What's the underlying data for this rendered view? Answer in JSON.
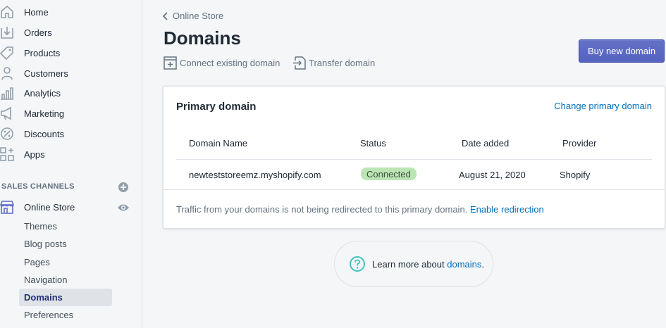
{
  "sidebar": {
    "items": [
      {
        "label": "Home",
        "icon": "home-icon"
      },
      {
        "label": "Orders",
        "icon": "orders-icon"
      },
      {
        "label": "Products",
        "icon": "tag-icon"
      },
      {
        "label": "Customers",
        "icon": "person-icon"
      },
      {
        "label": "Analytics",
        "icon": "bar-chart-icon"
      },
      {
        "label": "Marketing",
        "icon": "megaphone-icon"
      },
      {
        "label": "Discounts",
        "icon": "discount-icon"
      },
      {
        "label": "Apps",
        "icon": "apps-icon"
      }
    ],
    "sales_channels_heading": "SALES CHANNELS",
    "online_store": "Online Store",
    "sub_items": [
      "Themes",
      "Blog posts",
      "Pages",
      "Navigation",
      "Domains",
      "Preferences"
    ],
    "active_sub_item": "Domains"
  },
  "header": {
    "breadcrumb": "Online Store",
    "title": "Domains",
    "connect_label": "Connect existing domain",
    "transfer_label": "Transfer domain",
    "buy_label": "Buy new domain"
  },
  "card": {
    "title": "Primary domain",
    "change_link": "Change primary domain",
    "columns": [
      "Domain Name",
      "Status",
      "Date added",
      "Provider"
    ],
    "row": {
      "domain": "newteststoreemz.myshopify.com",
      "status": "Connected",
      "date": "August 21, 2020",
      "provider": "Shopify"
    },
    "footer_text": "Traffic from your domains is not being redirected to this primary domain.",
    "footer_link": "Enable redirection"
  },
  "help": {
    "prefix": "Learn more about",
    "link": "domains",
    "suffix": "."
  },
  "colors": {
    "accent": "#5c6ac4",
    "link": "#006fbb",
    "badge_success": "#bbe5b3"
  }
}
